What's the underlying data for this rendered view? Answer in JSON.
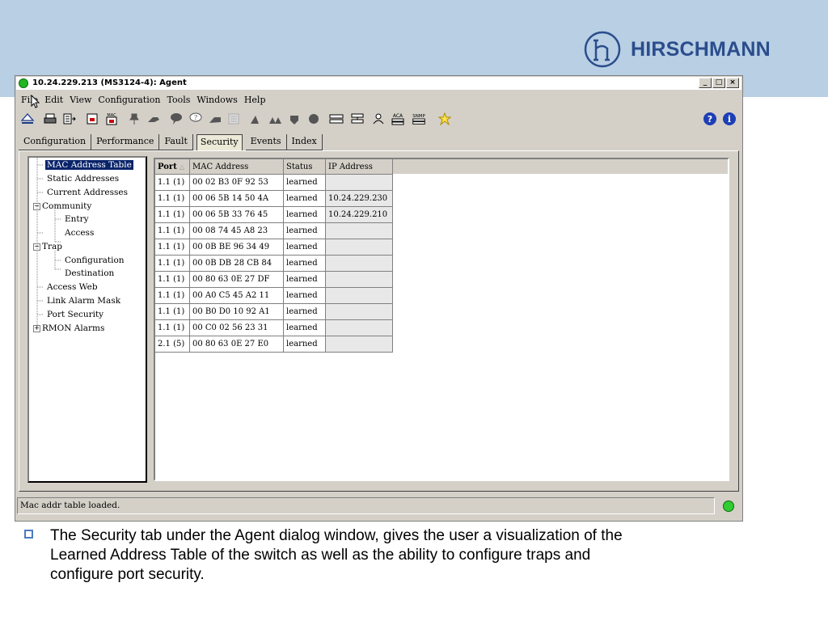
{
  "brand": {
    "name": "HIRSCHMANN",
    "color": "#2b4d8c"
  },
  "window": {
    "title": "10.24.229.213 (MS3124-4): Agent",
    "controls": [
      "_",
      "□",
      "×"
    ]
  },
  "menu": [
    "File",
    "Edit",
    "View",
    "Configuration",
    "Tools",
    "Windows",
    "Help"
  ],
  "toolbar_icons": [
    "eject-icon",
    "print-icon",
    "export-icon",
    "save-icon",
    "mac-icon",
    "pin-icon",
    "hand-icon",
    "bubble-icon",
    "help-bubble-icon",
    "flag-icon",
    "list-icon",
    "user-icon",
    "users-icon",
    "plug-icon",
    "circle-icon",
    "network-icon",
    "switch-icon",
    "person-icon",
    "aca-icon",
    "snmp-icon",
    "star-icon"
  ],
  "toolbar_labels": {
    "mac": "MAC",
    "aca": "ACA",
    "snmp": "SNMP"
  },
  "help_icons": [
    "?",
    "i"
  ],
  "tabs": [
    "Configuration",
    "Performance",
    "Fault",
    "Security",
    "Events",
    "Index"
  ],
  "active_tab": "Security",
  "tree": {
    "mac_table": "MAC Address Table",
    "static": "Static Addresses",
    "current": "Current Addresses",
    "community": "Community",
    "entry": "Entry",
    "access": "Access",
    "trap": "Trap",
    "trap_config": "Configuration",
    "destination": "Destination",
    "access_web": "Access Web",
    "link_alarm": "Link Alarm Mask",
    "port_security": "Port Security",
    "rmon": "RMON Alarms"
  },
  "table": {
    "headers": [
      "Port",
      "MAC Address",
      "Status",
      "IP Address"
    ],
    "rows": [
      [
        "1.1 (1)",
        "00 02 B3 0F 92 53",
        "learned",
        ""
      ],
      [
        "1.1 (1)",
        "00 06 5B 14 50 4A",
        "learned",
        "10.24.229.230"
      ],
      [
        "1.1 (1)",
        "00 06 5B 33 76 45",
        "learned",
        "10.24.229.210"
      ],
      [
        "1.1 (1)",
        "00 08 74 45 A8 23",
        "learned",
        ""
      ],
      [
        "1.1 (1)",
        "00 0B BE 96 34 49",
        "learned",
        ""
      ],
      [
        "1.1 (1)",
        "00 0B DB 28 CB 84",
        "learned",
        ""
      ],
      [
        "1.1 (1)",
        "00 80 63 0E 27 DF",
        "learned",
        ""
      ],
      [
        "1.1 (1)",
        "00 A0 C5 45 A2 11",
        "learned",
        ""
      ],
      [
        "1.1 (1)",
        "00 B0 D0 10 92 A1",
        "learned",
        ""
      ],
      [
        "1.1 (1)",
        "00 C0 02 56 23 31",
        "learned",
        ""
      ],
      [
        "2.1 (5)",
        "00 80 63 0E 27 E0",
        "learned",
        ""
      ]
    ]
  },
  "status": {
    "text": "Mac addr table loaded.",
    "led_color": "#33cc33"
  },
  "caption": "The Security tab under the Agent dialog window, gives the user a visualization of the Learned Address Table of the switch as well as the ability to configure traps and configure port security."
}
